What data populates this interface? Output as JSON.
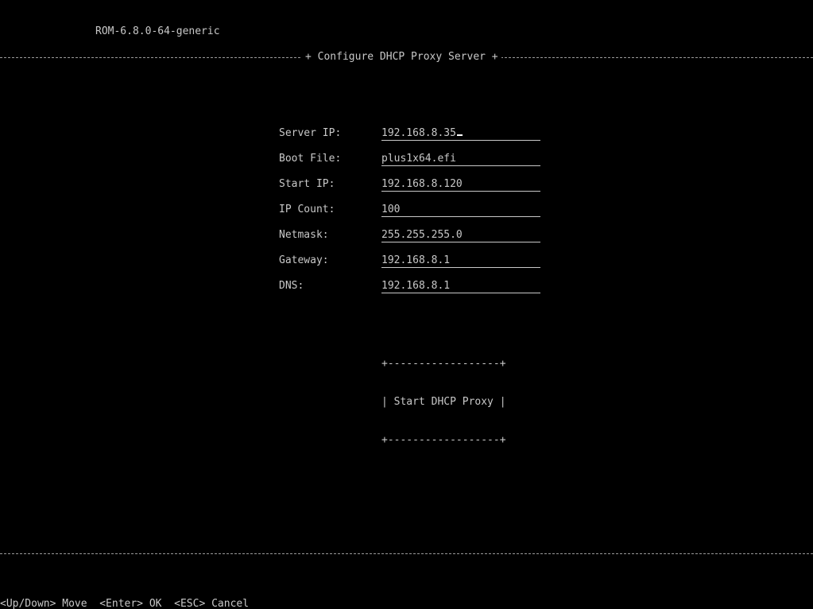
{
  "header": {
    "version": "ROM-6.8.0-64-generic",
    "title": "+ Configure DHCP Proxy Server +"
  },
  "form": {
    "fields": [
      {
        "label": "Server IP:",
        "value": "192.168.8.35"
      },
      {
        "label": "Boot File:",
        "value": "plus1x64.efi"
      },
      {
        "label": "Start IP:",
        "value": "192.168.8.120"
      },
      {
        "label": "IP Count:",
        "value": "100"
      },
      {
        "label": "Netmask:",
        "value": "255.255.255.0"
      },
      {
        "label": "Gateway:",
        "value": "192.168.8.1"
      },
      {
        "label": "DNS:",
        "value": "192.168.8.1"
      }
    ]
  },
  "button": {
    "border": "+------------------+",
    "label": "| Start DHCP Proxy |"
  },
  "footer": {
    "keys": "<Up/Down> Move  <Enter> OK  <ESC> Cancel"
  },
  "colors": {
    "background": "#000000",
    "text": "#c8c8c8"
  }
}
